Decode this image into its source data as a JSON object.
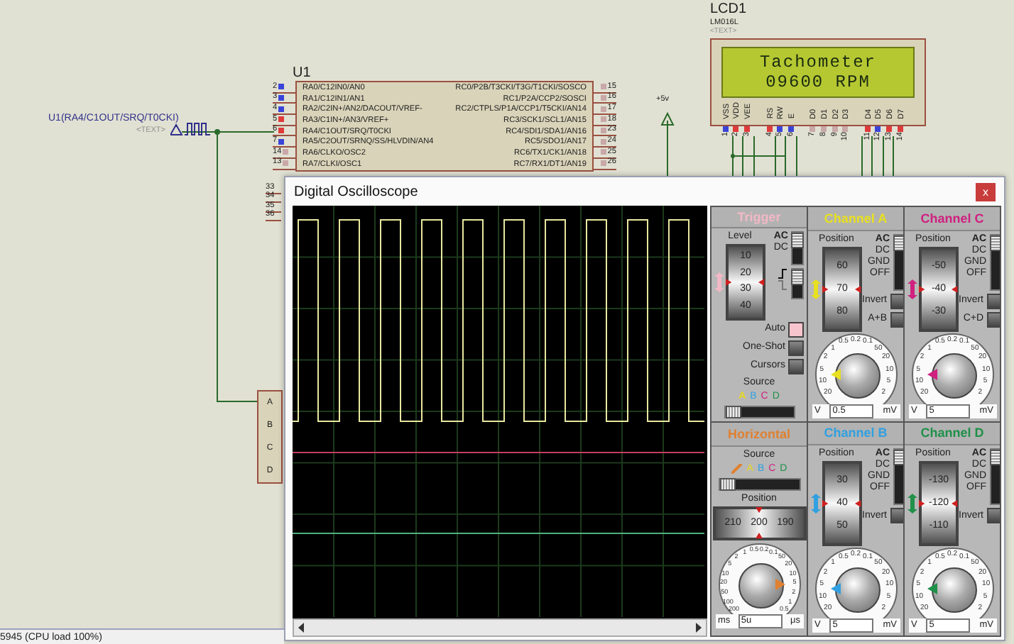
{
  "schematic": {
    "probe": {
      "label": "U1(RA4/C1OUT/SRQ/T0CKI)",
      "tag": "<TEXT>"
    },
    "mcu": {
      "ref": "U1",
      "left_pins": [
        {
          "number": "2",
          "name": "RA0/C12IN0/AN0",
          "driven": true,
          "high": false
        },
        {
          "number": "3",
          "name": "RA1/C12IN1/AN1",
          "driven": true,
          "high": false
        },
        {
          "number": "4",
          "name": "RA2/C2IN+/AN2/DACOUT/VREF-",
          "driven": true,
          "high": false
        },
        {
          "number": "5",
          "name": "RA3/C1IN+/AN3/VREF+",
          "driven": true,
          "high": true
        },
        {
          "number": "6",
          "name": "RA4/C1OUT/SRQ/T0CKI",
          "driven": true,
          "high": true
        },
        {
          "number": "7",
          "name": "RA5/C2OUT/SRNQ/SS/HLVDIN/AN4",
          "driven": true,
          "high": false
        },
        {
          "number": "14",
          "name": "RA6/CLKO/OSC2",
          "driven": false
        },
        {
          "number": "13",
          "name": "RA7/CLKI/OSC1",
          "driven": false
        }
      ],
      "right_pins": [
        {
          "number": "15",
          "name": "RC0/P2B/T3CKI/T3G/T1CKI/SOSCO",
          "driven": false
        },
        {
          "number": "16",
          "name": "RC1/P2A/CCP2/SOSCI",
          "driven": false
        },
        {
          "number": "17",
          "name": "RC2/CTPLS/P1A/CCP1/T5CKI/AN14",
          "driven": false
        },
        {
          "number": "18",
          "name": "RC3/SCK1/SCL1/AN15",
          "driven": false
        },
        {
          "number": "23",
          "name": "RC4/SDI1/SDA1/AN16",
          "driven": false
        },
        {
          "number": "24",
          "name": "RC5/SDO1/AN17",
          "driven": false
        },
        {
          "number": "25",
          "name": "RC6/TX1/CK1/AN18",
          "driven": false
        },
        {
          "number": "26",
          "name": "RC7/RX1/DT1/AN19",
          "driven": false
        }
      ],
      "lower_pins": [
        "33",
        "34",
        "35",
        "36"
      ]
    },
    "power": {
      "label": "+5v"
    },
    "lcd": {
      "ref": "LCD1",
      "part": "LM016L",
      "tag": "<TEXT>",
      "lines": [
        "Tachometer",
        "09600 RPM"
      ],
      "pins": [
        {
          "number": "1",
          "name": "VSS",
          "driven": true,
          "high": false
        },
        {
          "number": "2",
          "name": "VDD",
          "driven": true,
          "high": true
        },
        {
          "number": "3",
          "name": "VEE",
          "driven": true,
          "high": true
        },
        {
          "number": "4",
          "name": "RS",
          "driven": true,
          "high": true
        },
        {
          "number": "5",
          "name": "RW",
          "driven": true,
          "high": false
        },
        {
          "number": "6",
          "name": "E",
          "driven": true,
          "high": false
        },
        {
          "number": "7",
          "name": "D0",
          "driven": false
        },
        {
          "number": "8",
          "name": "D1",
          "driven": false
        },
        {
          "number": "9",
          "name": "D2",
          "driven": false
        },
        {
          "number": "10",
          "name": "D3",
          "driven": false
        },
        {
          "number": "11",
          "name": "D4",
          "driven": true,
          "high": true
        },
        {
          "number": "12",
          "name": "D5",
          "driven": true,
          "high": false
        },
        {
          "number": "13",
          "name": "D6",
          "driven": true,
          "high": true
        },
        {
          "number": "14",
          "name": "D7",
          "driven": true,
          "high": true
        }
      ]
    },
    "scope_inputs": [
      "A",
      "B",
      "C",
      "D"
    ]
  },
  "oscilloscope": {
    "title": "Digital Oscilloscope",
    "close": "x",
    "panels": [
      {
        "kind": "trigger",
        "title": "Trigger",
        "color": "#f2b8c6",
        "scale_label": "Level",
        "ticks": [
          "10",
          "20",
          "30",
          "40"
        ],
        "coupling": [
          {
            "label": "AC",
            "selected": true
          },
          {
            "label": "DC",
            "selected": false
          }
        ],
        "edge": [
          {
            "kind": "rising",
            "selected": true
          },
          {
            "kind": "falling",
            "selected": false
          }
        ],
        "toggles": [
          {
            "label": "Auto",
            "on": true
          },
          {
            "label": "One-Shot",
            "on": false
          },
          {
            "label": "Cursors",
            "on": false
          }
        ],
        "source_label": "Source",
        "sources": [
          {
            "kind": "channel",
            "label": "A",
            "color": "#e8d820",
            "selected": true
          },
          {
            "kind": "channel",
            "label": "B",
            "color": "#30a0e0",
            "selected": false
          },
          {
            "kind": "channel",
            "label": "C",
            "color": "#d02080",
            "selected": false
          },
          {
            "kind": "channel",
            "label": "D",
            "color": "#20904a",
            "selected": false
          }
        ]
      },
      {
        "kind": "channel",
        "title": "Channel A",
        "color": "#e8e020",
        "scale_label": "Position",
        "ticks": [
          "60",
          "70",
          "80"
        ],
        "coupling": [
          {
            "label": "AC",
            "selected": true
          },
          {
            "label": "DC",
            "selected": false
          },
          {
            "label": "GND",
            "selected": false
          },
          {
            "label": "OFF",
            "selected": false
          }
        ],
        "toggles": [
          {
            "label": "Invert",
            "on": false
          },
          {
            "label": "A+B",
            "on": false
          }
        ],
        "dial": {
          "scale": [
            "0.5",
            "0.2",
            "0.1",
            "1",
            "50",
            "2",
            "20",
            "5",
            "10",
            "10",
            "5",
            "20",
            "2"
          ],
          "units": [
            "V",
            "mV"
          ],
          "value": "0.5"
        }
      },
      {
        "kind": "channel",
        "title": "Channel C",
        "color": "#d02080",
        "scale_label": "Position",
        "ticks": [
          "-50",
          "-40",
          "-30"
        ],
        "coupling": [
          {
            "label": "AC",
            "selected": true
          },
          {
            "label": "DC",
            "selected": false
          },
          {
            "label": "GND",
            "selected": false
          },
          {
            "label": "OFF",
            "selected": false
          }
        ],
        "toggles": [
          {
            "label": "Invert",
            "on": false
          },
          {
            "label": "C+D",
            "on": false
          }
        ],
        "dial": {
          "scale": [
            "0.5",
            "0.2",
            "0.1",
            "1",
            "50",
            "2",
            "20",
            "5",
            "10",
            "10",
            "5",
            "20",
            "2"
          ],
          "units": [
            "V",
            "mV"
          ],
          "value": "5"
        }
      },
      {
        "kind": "horizontal",
        "title": "Horizontal",
        "color": "#e08030",
        "source_label": "Source",
        "sources": [
          {
            "kind": "ramp",
            "color": "#e08030",
            "selected": true
          },
          {
            "kind": "channel",
            "label": "A",
            "color": "#e8d820",
            "selected": false
          },
          {
            "kind": "channel",
            "label": "B",
            "color": "#30a0e0",
            "selected": false
          },
          {
            "kind": "channel",
            "label": "C",
            "color": "#d02080",
            "selected": false
          },
          {
            "kind": "channel",
            "label": "D",
            "color": "#20904a",
            "selected": false
          }
        ],
        "scale_label": "Position",
        "ticks": [
          "210",
          "200",
          "190"
        ],
        "dial": {
          "scale": [
            "1",
            "0.5",
            "0.2",
            "0.1",
            "2",
            "50",
            "5",
            "20",
            "10",
            "10",
            "20",
            "5",
            "50",
            "2",
            "100",
            "1",
            "200",
            "0.5"
          ],
          "units": [
            "ms",
            "μs"
          ],
          "value": "5u"
        }
      },
      {
        "kind": "channel",
        "title": "Channel B",
        "color": "#30a0e0",
        "scale_label": "Position",
        "ticks": [
          "30",
          "40",
          "50"
        ],
        "coupling": [
          {
            "label": "AC",
            "selected": true
          },
          {
            "label": "DC",
            "selected": false
          },
          {
            "label": "GND",
            "selected": false
          },
          {
            "label": "OFF",
            "selected": false
          }
        ],
        "toggles": [
          {
            "label": "Invert",
            "on": false
          }
        ],
        "dial": {
          "scale": [
            "0.5",
            "0.2",
            "0.1",
            "1",
            "50",
            "2",
            "20",
            "5",
            "10",
            "10",
            "5",
            "20",
            "2"
          ],
          "units": [
            "V",
            "mV"
          ],
          "value": "5"
        }
      },
      {
        "kind": "channel",
        "title": "Channel D",
        "color": "#20904a",
        "scale_label": "Position",
        "ticks": [
          "-130",
          "-120",
          "-110"
        ],
        "coupling": [
          {
            "label": "AC",
            "selected": true
          },
          {
            "label": "DC",
            "selected": false
          },
          {
            "label": "GND",
            "selected": false
          },
          {
            "label": "OFF",
            "selected": false
          }
        ],
        "toggles": [
          {
            "label": "Invert",
            "on": false
          }
        ],
        "dial": {
          "scale": [
            "0.5",
            "0.2",
            "0.1",
            "1",
            "50",
            "2",
            "20",
            "5",
            "10",
            "10",
            "5",
            "20",
            "2"
          ],
          "units": [
            "V",
            "mV"
          ],
          "value": "5"
        }
      }
    ]
  },
  "status_bar": {
    "text": "5945 (CPU load 100%)"
  }
}
